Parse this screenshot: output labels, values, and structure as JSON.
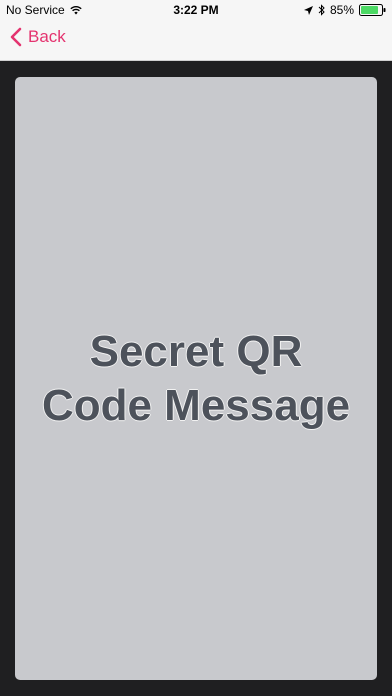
{
  "status_bar": {
    "carrier": "No Service",
    "time": "3:22 PM",
    "battery": "85%",
    "battery_level": 0.85
  },
  "nav": {
    "back_label": "Back"
  },
  "card": {
    "message_line1": "Secret QR",
    "message_line2": "Code Message"
  },
  "colors": {
    "accent": "#e4336f",
    "background": "#1f1f21",
    "card": "#c8c9cd",
    "text": "#4d525b",
    "battery": "#4cd964"
  }
}
